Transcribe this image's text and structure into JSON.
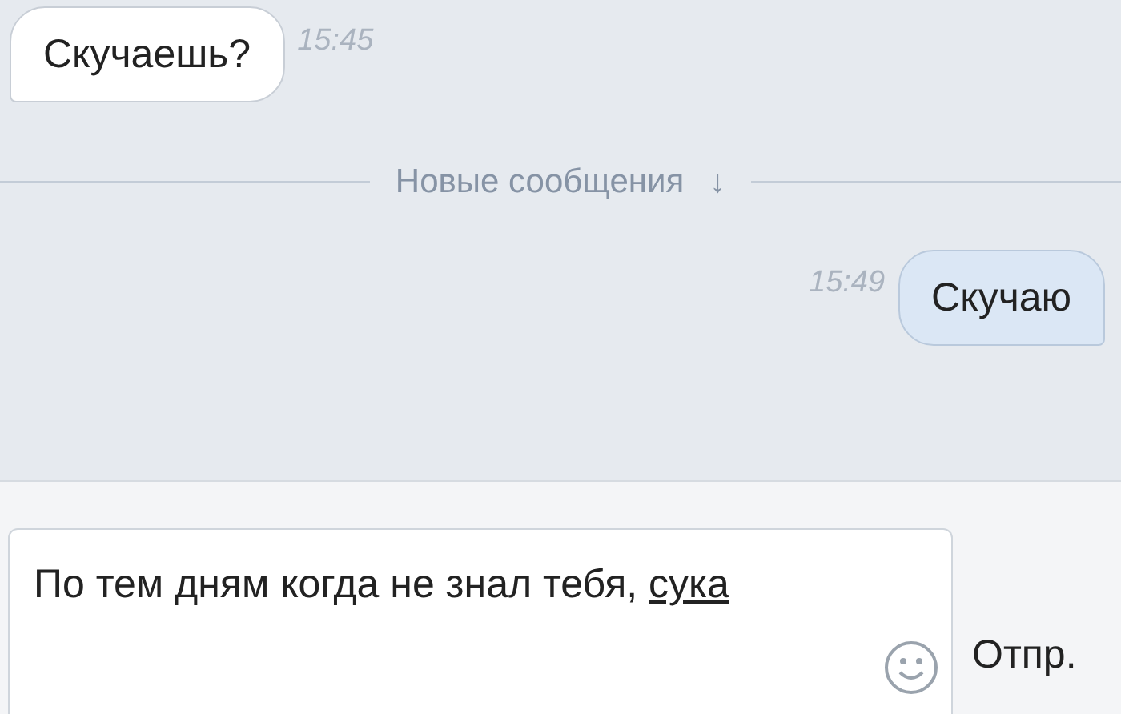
{
  "messages": [
    {
      "kind": "incoming",
      "text": "Скучаешь?",
      "time": "15:45"
    },
    {
      "kind": "divider",
      "text": "Новые сообщения",
      "arrow": "↓"
    },
    {
      "kind": "outgoing",
      "text": "Скучаю",
      "time": "15:49"
    }
  ],
  "composer": {
    "value": "По тем дням когда не знал тебя,",
    "misspelled_word": "сука",
    "send_label": "Отпр."
  }
}
